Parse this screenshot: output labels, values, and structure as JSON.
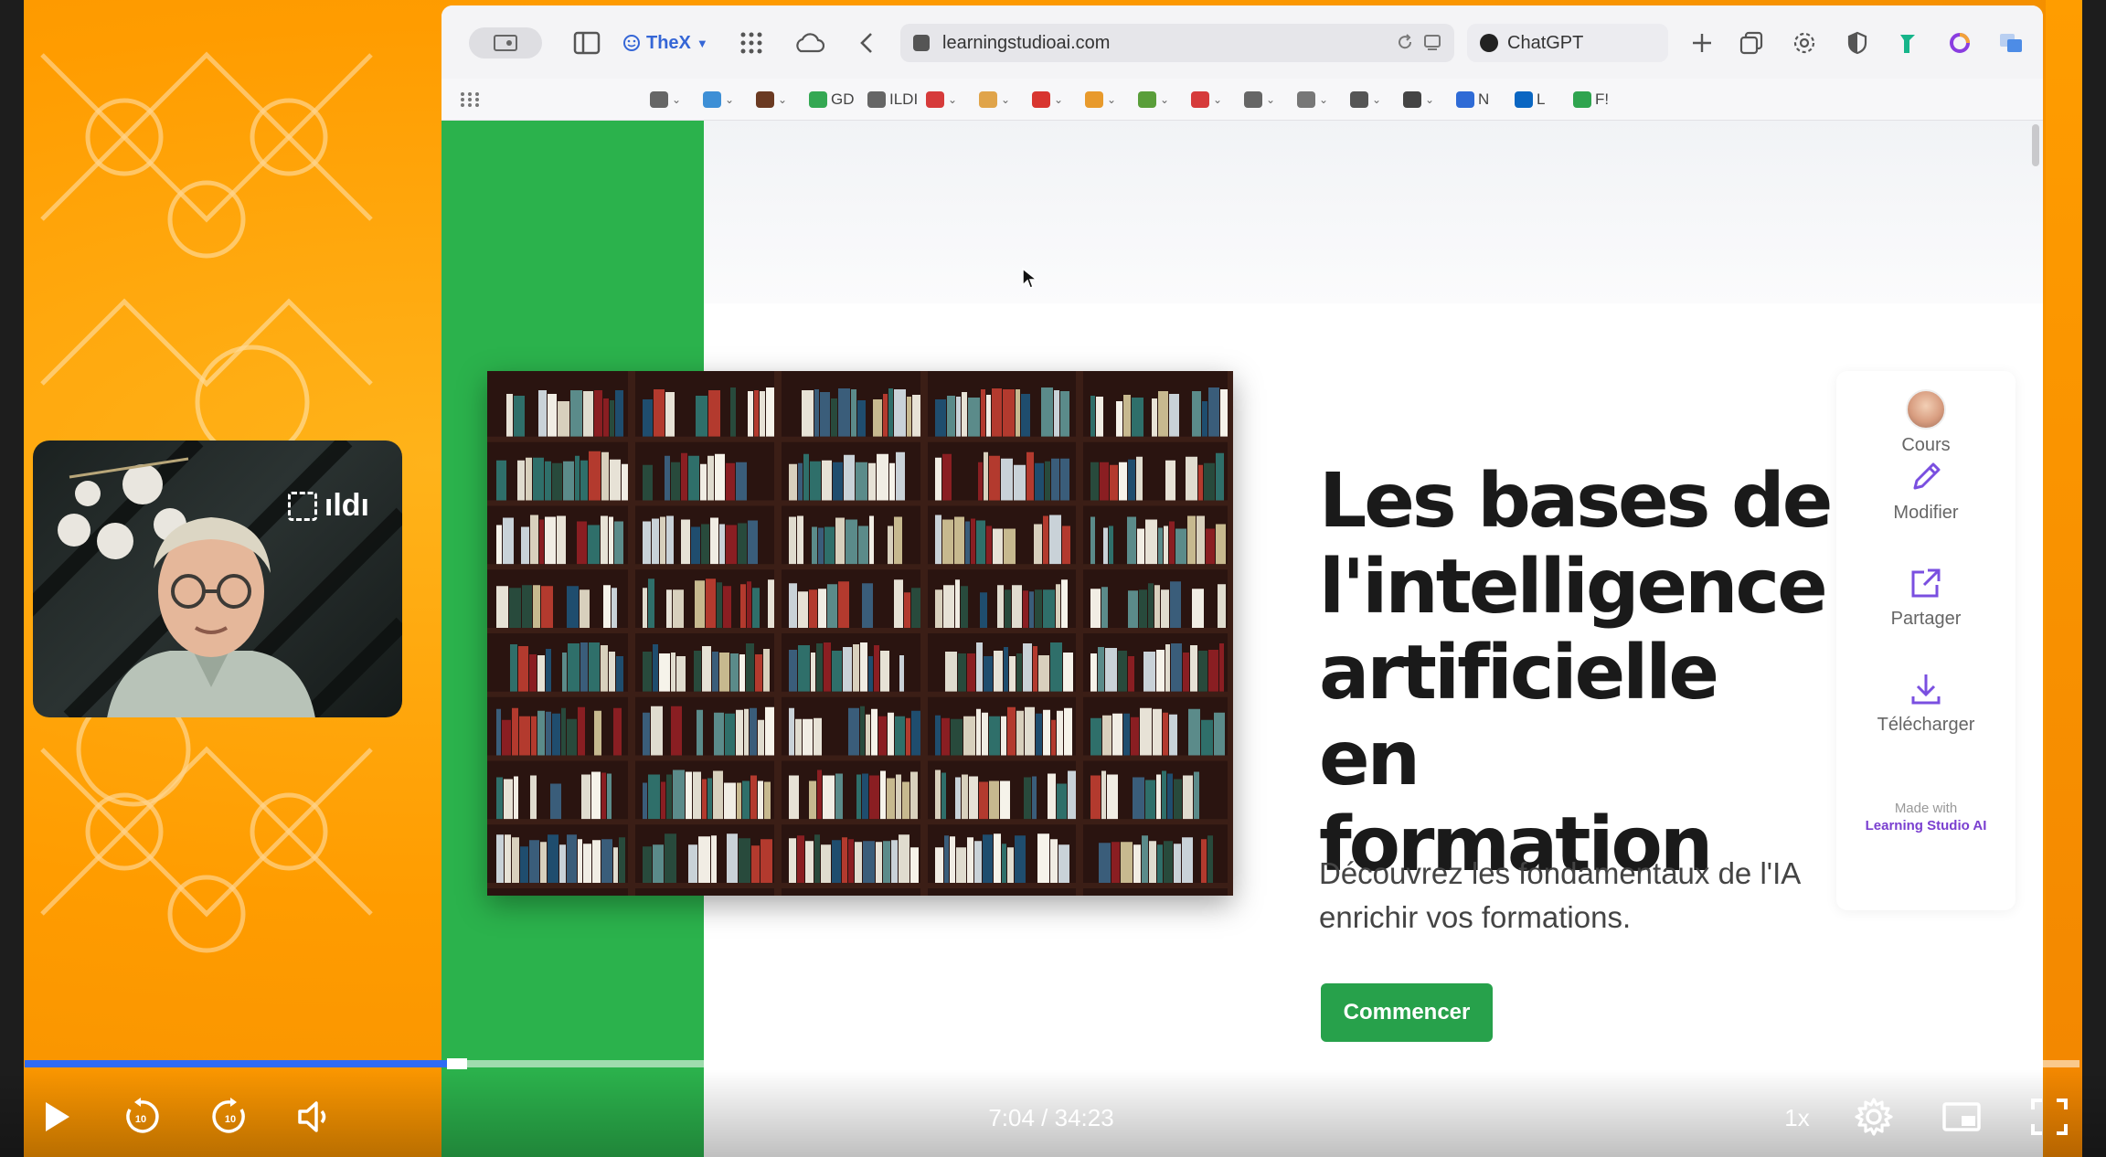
{
  "browser": {
    "thex_label": "TheX",
    "url": "learningstudioai.com",
    "second_tab_label": "ChatGPT"
  },
  "bookmarks": [
    {
      "label": "",
      "icon": "search-icon"
    },
    {
      "label": "",
      "icon": "cart-icon"
    },
    {
      "label": "",
      "icon": "briefcase-icon"
    },
    {
      "label": "GD",
      "icon": "google-drive-icon"
    },
    {
      "label": "ILDI",
      "icon": "folder-icon"
    },
    {
      "label": "",
      "icon": "toolbox-icon"
    },
    {
      "label": "",
      "icon": "tiger-icon"
    },
    {
      "label": "",
      "icon": "gift-icon"
    },
    {
      "label": "",
      "icon": "taco-icon"
    },
    {
      "label": "",
      "icon": "plant-icon"
    },
    {
      "label": "",
      "icon": "car-icon"
    },
    {
      "label": "",
      "icon": "music-folder-icon"
    },
    {
      "label": "",
      "icon": "cart-icon"
    },
    {
      "label": "",
      "icon": "tools-icon"
    },
    {
      "label": "",
      "icon": "monitor-icon"
    },
    {
      "label": "N",
      "icon": "gb-flag-icon"
    },
    {
      "label": "L",
      "icon": "linkedin-icon"
    },
    {
      "label": "F!",
      "icon": "diamond-icon"
    }
  ],
  "page": {
    "title": "Les bases de l'intelligence artificielle en formation",
    "subtitle_line1": "Découvrez les fondamentaux de l'IA",
    "subtitle_line2": "enrichir vos formations.",
    "start_button": "Commencer",
    "actions": {
      "courses": "Cours",
      "edit": "Modifier",
      "share": "Partager",
      "download": "Télécharger"
    },
    "made_with": "Made with",
    "made_with_brand": "Learning Studio AI"
  },
  "webcam": {
    "logo_text": "ıldı"
  },
  "player": {
    "current_time": "7:04",
    "duration": "34:23",
    "time_display": "7:04 / 34:23",
    "progress_fraction": 0.2056,
    "speed": "1x",
    "accent_color": "#2f6bf5"
  }
}
